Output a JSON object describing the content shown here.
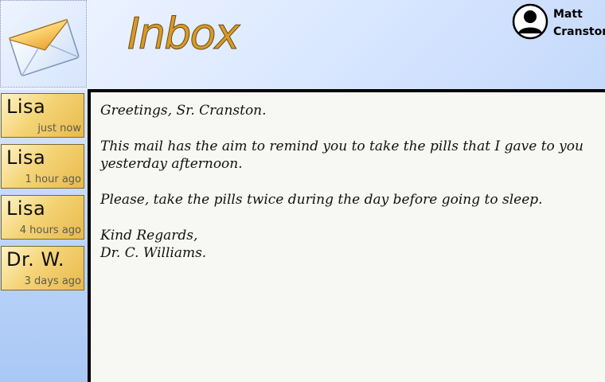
{
  "app": {
    "title": "Inbox"
  },
  "user": {
    "first_name": "Matt",
    "last_name": "Cranston"
  },
  "mail_list": [
    {
      "sender": "Lisa",
      "time": "just now"
    },
    {
      "sender": "Lisa",
      "time": "1 hour ago"
    },
    {
      "sender": "Lisa",
      "time": "4 hours ago"
    },
    {
      "sender": "Dr. W.",
      "time": "3 days ago"
    }
  ],
  "message": {
    "greeting": "Greetings, Sr. Cranston.",
    "line1": "This mail has the aim to remind you to take the pills that I gave to you",
    "line2": "yesterday afternoon.",
    "line3": "Please, take the pills twice during the day before going to sleep.",
    "signoff1": "Kind Regards,",
    "signoff2": "Dr. C. Williams."
  },
  "colors": {
    "accent": "#d79a2a",
    "mail_item": "#f4d476",
    "sidebar": "#b9d2f9",
    "message_bg": "#f7f7f3"
  }
}
